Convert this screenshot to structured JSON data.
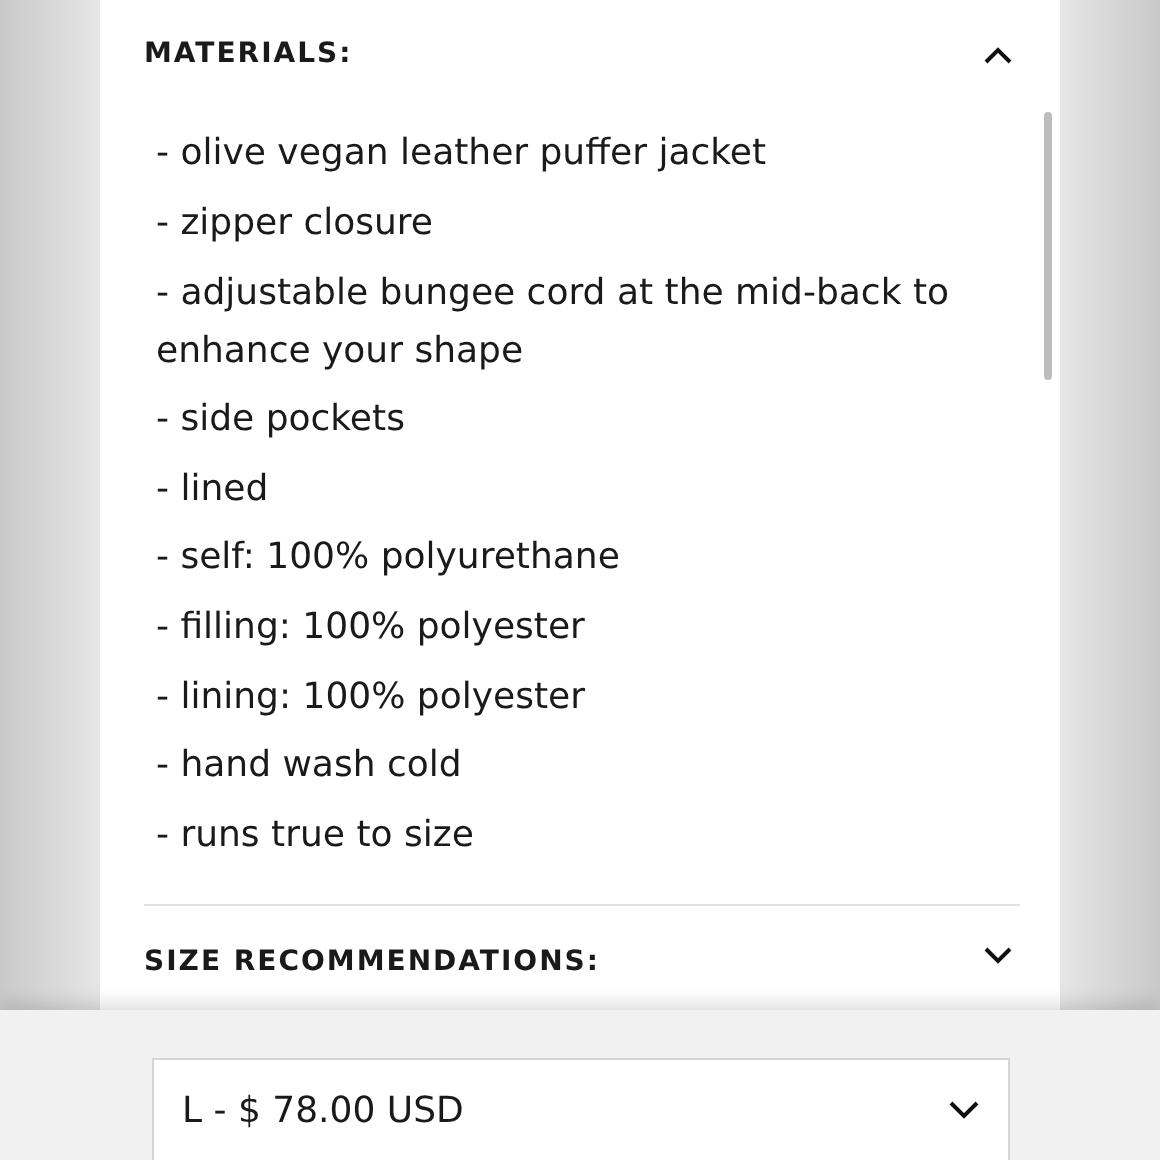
{
  "sections": [
    {
      "title": "MATERIALS:",
      "expanded": true,
      "items": [
        "- olive vegan leather puffer jacket",
        "- zipper closure",
        "- adjustable bungee cord at the mid-back to enhance your shape",
        "- side pockets",
        "- lined",
        "- self: 100% polyurethane",
        "- filling: 100% polyester",
        "- lining: 100% polyester",
        "- hand wash cold",
        "- runs true to size"
      ]
    },
    {
      "title": "SIZE RECOMMENDATIONS:",
      "expanded": false
    }
  ],
  "variant_select": {
    "value": "L - $ 78.00 USD"
  }
}
